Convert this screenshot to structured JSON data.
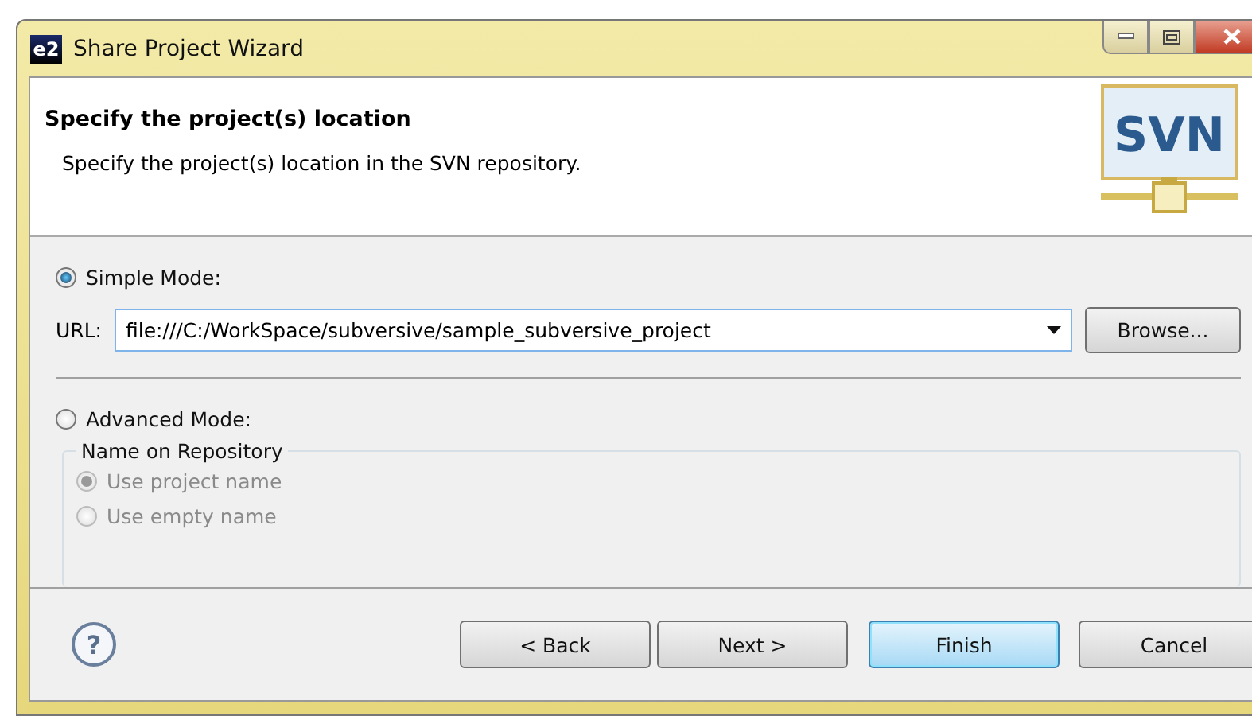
{
  "window": {
    "title": "Share Project Wizard",
    "app_icon": "e2"
  },
  "header": {
    "title": "Specify the project(s) location",
    "description": "Specify the project(s) location in the SVN repository.",
    "logo": "SVN"
  },
  "simple_mode": {
    "label": "Simple Mode:",
    "selected": true,
    "url_label": "URL:",
    "url_value": "file:///C:/WorkSpace/subversive/sample_subversive_project",
    "browse": "Browse..."
  },
  "advanced_mode": {
    "label": "Advanced Mode:",
    "selected": false,
    "group_title": "Name on Repository",
    "options": [
      {
        "label": "Use project name",
        "selected": true,
        "disabled": true
      },
      {
        "label": "Use empty name",
        "selected": false,
        "disabled": true
      }
    ]
  },
  "help": "?",
  "buttons": [
    {
      "label": "< Back",
      "default": false
    },
    {
      "label": "Next >",
      "default": false
    },
    {
      "label": "Finish",
      "default": true
    },
    {
      "label": "Cancel",
      "default": false
    }
  ]
}
